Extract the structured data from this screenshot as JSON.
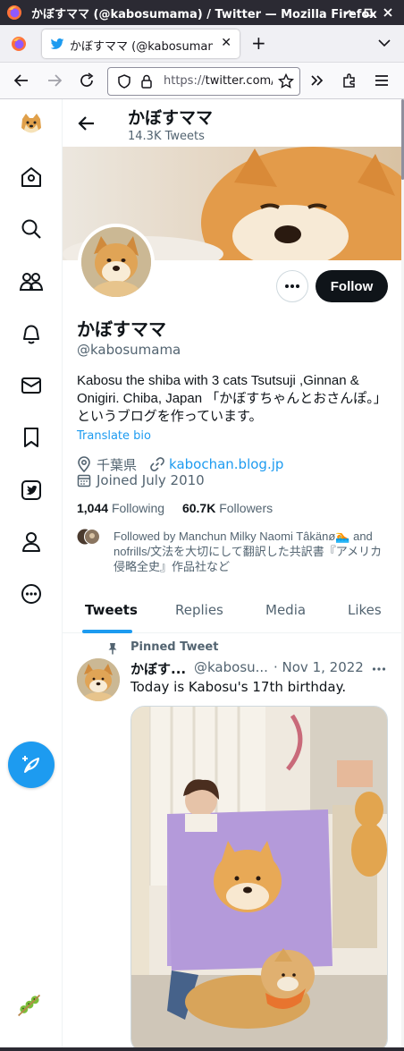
{
  "window": {
    "title": "かぼすママ (@kabosumama) / Twitter — Mozilla Firefox",
    "controls": [
      "minimize-icon",
      "maximize-icon",
      "close-icon"
    ]
  },
  "browser": {
    "tab_title": "かぼすママ (@kabosumama) / Twitter",
    "url_scheme": "https://",
    "url_host": "twitter.com/kabosumama"
  },
  "sidebar": {
    "items": [
      {
        "name": "doge-logo",
        "icon": "doge-icon"
      },
      {
        "name": "home",
        "icon": "home-icon"
      },
      {
        "name": "explore",
        "icon": "search-icon"
      },
      {
        "name": "communities",
        "icon": "people-icon"
      },
      {
        "name": "notifications",
        "icon": "bell-icon"
      },
      {
        "name": "messages",
        "icon": "mail-icon"
      },
      {
        "name": "bookmarks",
        "icon": "bookmark-icon"
      },
      {
        "name": "twitter-blue",
        "icon": "twitter-blue-icon"
      },
      {
        "name": "profile",
        "icon": "person-icon"
      },
      {
        "name": "more",
        "icon": "more-circle-icon"
      }
    ],
    "tweet_button_icon": "compose-feather-icon"
  },
  "header": {
    "name": "かぼすママ",
    "tweet_count": "14.3K Tweets"
  },
  "profile": {
    "name": "かぼすママ",
    "handle": "@kabosumama",
    "follow_label": "Follow",
    "bio": "Kabosu the shiba with 3 cats Tsutsuji ,Ginnan & Onigiri. Chiba, Japan 「かぼすちゃんとおさんぽ。」というブログを作っています。",
    "translate_label": "Translate bio",
    "location": "千葉県",
    "website": "kabochan.blog.jp",
    "joined": "Joined July 2010",
    "following_count": "1,044",
    "following_label": "Following",
    "followers_count": "60.7K",
    "followers_label": "Followers",
    "followed_by": "Followed by Manchun Milky Naomi Tâkänø🏊 and nofrills/文法を大切にして翻訳した共訳書『アメリカ侵略全史』作品社など"
  },
  "tabs": [
    {
      "label": "Tweets",
      "active": true
    },
    {
      "label": "Replies",
      "active": false
    },
    {
      "label": "Media",
      "active": false
    },
    {
      "label": "Likes",
      "active": false
    }
  ],
  "tweet": {
    "pinned_label": "Pinned Tweet",
    "author_name": "かぼす...",
    "author_handle": "@kabosu...",
    "date": "· Nov 1, 2022",
    "text": "Today is Kabosu's 17th birthday."
  },
  "colors": {
    "accent": "#1d9bf0",
    "text": "#0f1419",
    "secondary": "#536471",
    "titlebar": "#2b2a33"
  }
}
